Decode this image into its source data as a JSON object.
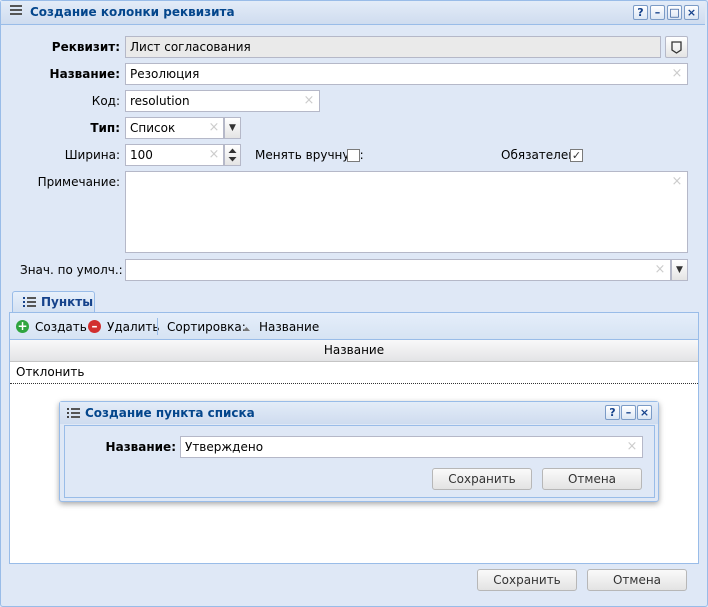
{
  "window": {
    "title": "Создание колонки реквизита",
    "tools": [
      "?",
      "–",
      "□",
      "×"
    ]
  },
  "form": {
    "rekvizit": {
      "label": "Реквизит:",
      "value": "Лист согласования"
    },
    "name": {
      "label": "Название:",
      "value": "Резолюция"
    },
    "code": {
      "label": "Код:",
      "value": "resolution"
    },
    "type": {
      "label": "Тип:",
      "value": "Список"
    },
    "width": {
      "label": "Ширина:",
      "value": "100"
    },
    "manual": {
      "label": "Менять вручную:",
      "checked": false
    },
    "required": {
      "label": "Обязателен:",
      "checked": true
    },
    "note": {
      "label": "Примечание:",
      "value": ""
    },
    "default": {
      "label": "Знач. по умолч.:",
      "value": ""
    }
  },
  "tab": {
    "label": "Пункты"
  },
  "toolbar": {
    "create_label": "Создать",
    "delete_label": "Удалить",
    "sort_label": "Сортировка:",
    "sort_field": "Название"
  },
  "grid": {
    "column_header": "Название",
    "rows": [
      "Отклонить"
    ]
  },
  "dialog": {
    "title": "Создание пункта списка",
    "tools": [
      "?",
      "–",
      "×"
    ],
    "name_label": "Название:",
    "name_value": "Утверждено",
    "save_label": "Сохранить",
    "cancel_label": "Отмена"
  },
  "footer": {
    "save_label": "Сохранить",
    "cancel_label": "Отмена"
  },
  "icons": {
    "menu": "menu-icon",
    "lookup": "tag-icon",
    "clear": "clear-x-icon",
    "add": "add-circle-icon",
    "delete": "remove-circle-icon",
    "sort": "sort-asc-icon"
  },
  "colors": {
    "accent": "#15428b",
    "border": "#99bce8",
    "background": "#dfe8f6",
    "add": "#2fa53f",
    "delete": "#d22f2f"
  }
}
